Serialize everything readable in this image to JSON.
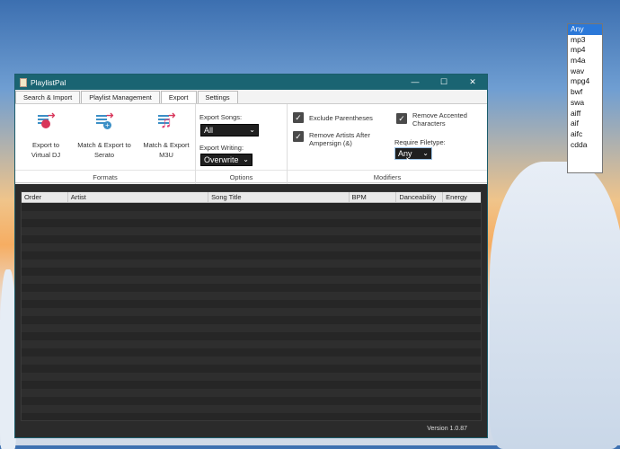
{
  "window": {
    "title": "PlaylistPal",
    "controls": {
      "minimize": "—",
      "maximize": "☐",
      "close": "✕"
    }
  },
  "tabs": [
    "Search & Import",
    "Playlist Management",
    "Export",
    "Settings"
  ],
  "active_tab": "Export",
  "formats": {
    "group_label": "Formats",
    "buttons": [
      {
        "label": "Export to Virtual DJ",
        "icon": "virtualdj-export-icon"
      },
      {
        "label": "Match & Export to Serato",
        "icon": "serato-export-icon"
      },
      {
        "label": "Match & Export M3U",
        "icon": "m3u-export-icon"
      }
    ]
  },
  "options": {
    "group_label": "Options",
    "export_songs_label": "Export Songs:",
    "export_songs_value": "All",
    "export_writing_label": "Export Writing:",
    "export_writing_value": "Overwrite"
  },
  "modifiers": {
    "group_label": "Modifiers",
    "exclude_parentheses": {
      "label": "Exclude Parentheses",
      "checked": true
    },
    "remove_artists": {
      "label": "Remove Artists After Ampersign (&)",
      "checked": true
    },
    "remove_accented": {
      "label": "Remove Accented Characters",
      "checked": true
    },
    "require_filetype_label": "Require Filetype:",
    "require_filetype_value": "Any"
  },
  "filetype_options": [
    "Any",
    "mp3",
    "mp4",
    "m4a",
    "wav",
    "mpg4",
    "bwf",
    "swa",
    "aiff",
    "aif",
    "aifc",
    "cdda"
  ],
  "table": {
    "columns": [
      "Order",
      "Artist",
      "Song Title",
      "BPM",
      "Danceability",
      "Energy"
    ]
  },
  "status": {
    "version": "Version 1.0.87"
  },
  "colors": {
    "titlebar": "#1a6472",
    "accent_selected": "#2b78d8",
    "icon_pink": "#d8365a",
    "icon_blue": "#3c8fc6"
  }
}
